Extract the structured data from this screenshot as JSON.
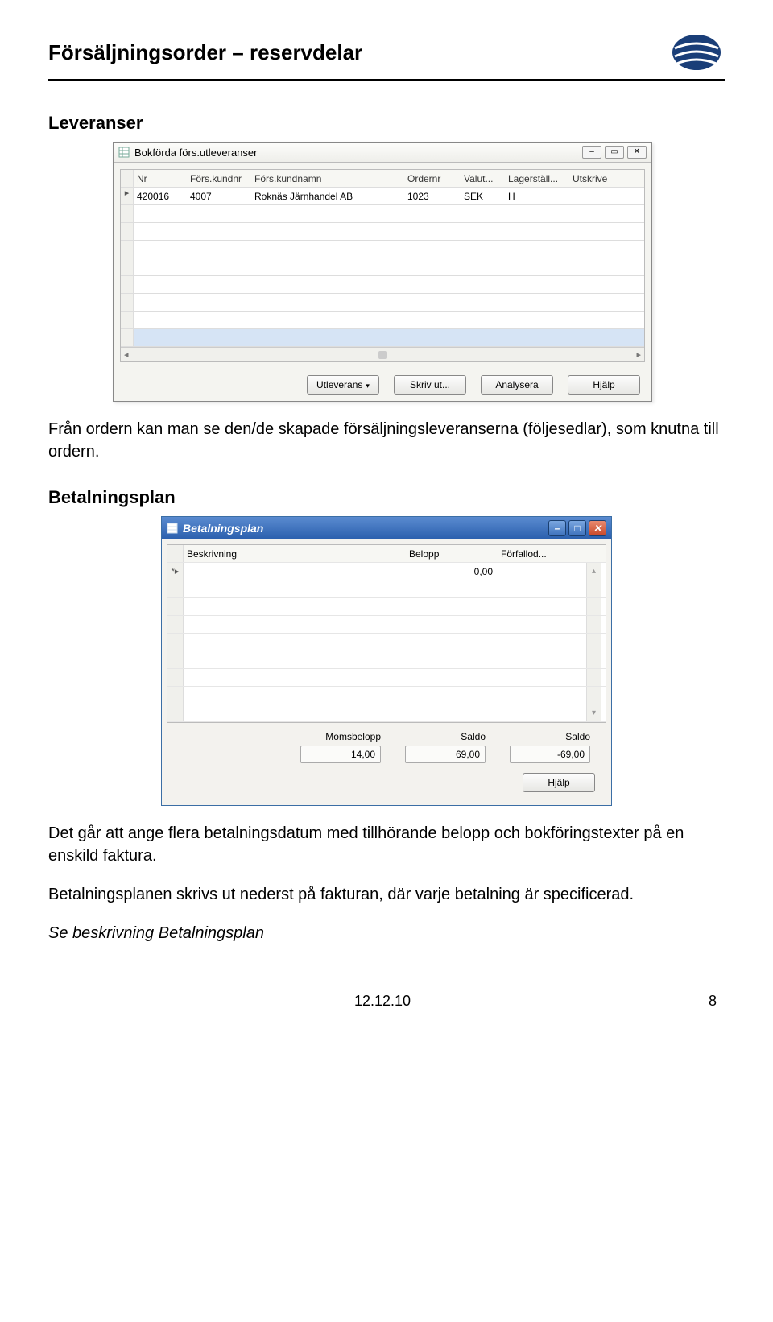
{
  "header": {
    "title": "Försäljningsorder – reservdelar"
  },
  "section1": {
    "title": "Leveranser",
    "text": "Från ordern kan man se den/de skapade försäljningsleveranserna (följesedlar), som knutna till ordern."
  },
  "window1": {
    "title": "Bokförda förs.utleveranser",
    "columns": {
      "nr": "Nr",
      "kundnr": "Förs.kundnr",
      "kundnamn": "Förs.kundnamn",
      "ordernr": "Ordernr",
      "valut": "Valut...",
      "lager": "Lagerställ...",
      "utskr": "Utskrive"
    },
    "row": {
      "nr": "420016",
      "kundnr": "4007",
      "kundnamn": "Roknäs Järnhandel AB",
      "ordernr": "1023",
      "valut": "SEK",
      "lager": "H",
      "utskr": ""
    },
    "buttons": {
      "utleverans": "Utleverans",
      "skrivut": "Skriv ut...",
      "analysera": "Analysera",
      "hjalp": "Hjälp"
    }
  },
  "section2": {
    "title": "Betalningsplan",
    "p1": "Det går att ange flera betalningsdatum med tillhörande belopp och bokföringstexter på en enskild faktura.",
    "p2": "Betalningsplanen skrivs ut nederst på fakturan, där varje betalning är specificerad.",
    "p3": "Se beskrivning Betalningsplan"
  },
  "window2": {
    "title": "Betalningsplan",
    "columns": {
      "besk": "Beskrivning",
      "belopp": "Belopp",
      "forfall": "Förfallod..."
    },
    "row": {
      "belopp": "0,00"
    },
    "sumlabels": {
      "moms": "Momsbelopp",
      "saldo1": "Saldo",
      "saldo2": "Saldo"
    },
    "sumvals": {
      "moms": "14,00",
      "saldo1": "69,00",
      "saldo2": "-69,00"
    },
    "help": "Hjälp"
  },
  "footer": {
    "date": "12.12.10",
    "page": "8"
  }
}
